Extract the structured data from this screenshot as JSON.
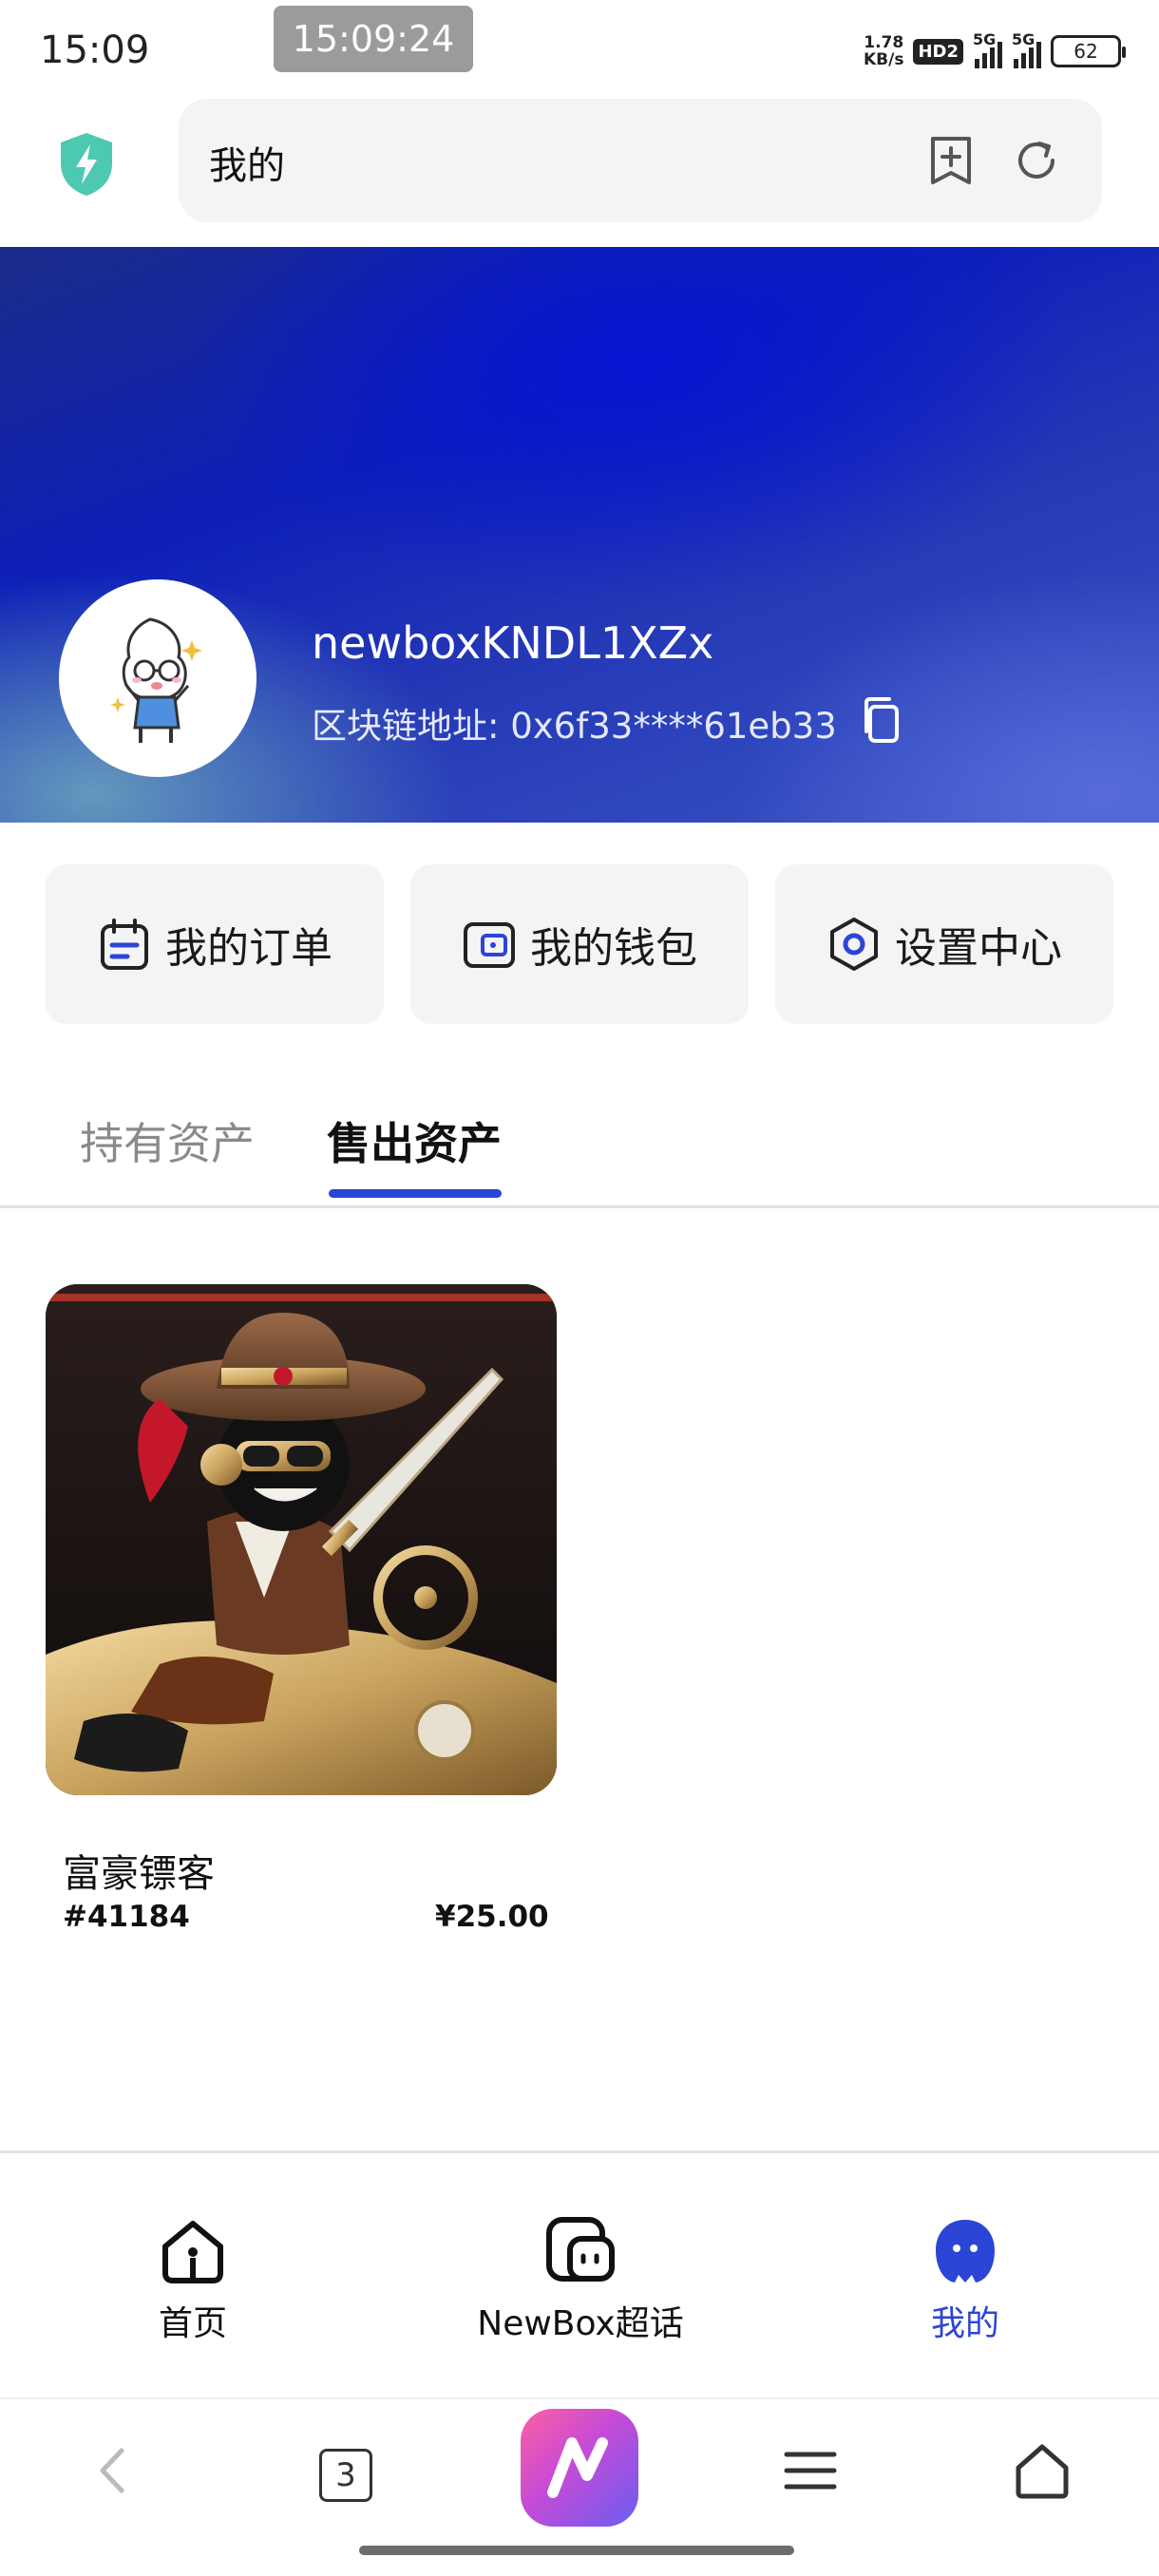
{
  "status_bar": {
    "time": "15:09",
    "overlay_time": "15:09:24",
    "net_speed_value": "1.78",
    "net_speed_unit": "KB/s",
    "hd_badge": "HD2",
    "network_1": "5G",
    "network_2": "5G",
    "battery": "62"
  },
  "address_bar": {
    "title": "我的",
    "icons": [
      "shield-bolt-icon",
      "add-bookmark-icon",
      "refresh-icon"
    ]
  },
  "profile": {
    "username": "newboxKNDL1XZx",
    "chain_address_label": "区块链地址:",
    "chain_address_value": "0x6f33****61eb33"
  },
  "actions": [
    {
      "label": "我的订单",
      "icon": "calendar-order-icon"
    },
    {
      "label": "我的钱包",
      "icon": "wallet-icon"
    },
    {
      "label": "设置中心",
      "icon": "settings-hexagon-icon"
    }
  ],
  "tabs": [
    {
      "label": "持有资产",
      "active": false
    },
    {
      "label": "售出资产",
      "active": true
    }
  ],
  "products": [
    {
      "name": "富豪镖客",
      "serial": "#41184",
      "price": "¥25.00"
    }
  ],
  "bottom_nav": [
    {
      "label": "首页",
      "icon": "home-icon",
      "active": false
    },
    {
      "label": "NewBox超话",
      "icon": "chat-bubble-icon",
      "active": false
    },
    {
      "label": "我的",
      "icon": "profile-blob-icon",
      "active": true
    }
  ],
  "browser_toolbar": {
    "tab_count": "3",
    "icons": [
      "back-arrow-icon",
      "tabs-icon",
      "newbox-app-icon",
      "menu-icon",
      "home-outline-icon"
    ]
  },
  "colors": {
    "accent": "#2b45d6",
    "banner_deep": "#0d1fb8",
    "card_bg": "#f4f4f6"
  }
}
